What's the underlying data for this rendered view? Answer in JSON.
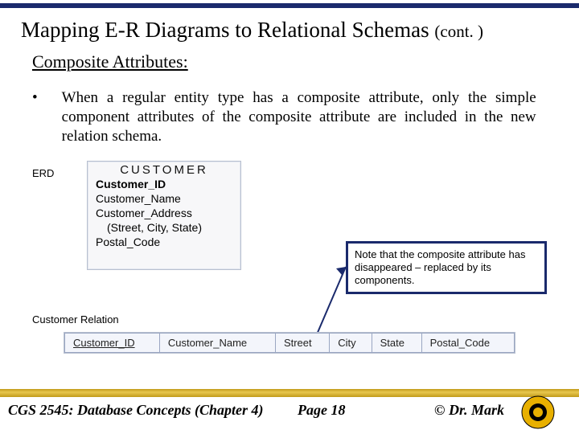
{
  "title_main": "Mapping E-R Diagrams to Relational Schemas ",
  "title_cont": "(cont. )",
  "section_heading": "Composite Attributes:",
  "bullet_mark": "•",
  "bullet_text": "When a regular entity type has a composite attribute, only the simple component attributes of the composite attribute are included in the new relation schema.",
  "erd_label": "ERD",
  "erd": {
    "title": "CUSTOMER",
    "lines": {
      "l0": "Customer_ID",
      "l1": "Customer_Name",
      "l2": "Customer_Address",
      "l3": "(Street, City, State)",
      "l4": "Postal_Code"
    }
  },
  "note_text": "Note that the composite attribute has disappeared – replaced by its components.",
  "relation_label": "Customer Relation",
  "cols": {
    "c0": "Customer_ID",
    "c1": "Customer_Name",
    "c2": "Street",
    "c3": "City",
    "c4": "State",
    "c5": "Postal_Code"
  },
  "footer": {
    "course": "CGS 2545: Database Concepts  (Chapter 4)",
    "page": "Page 18",
    "author": "©  Dr. Mark"
  }
}
